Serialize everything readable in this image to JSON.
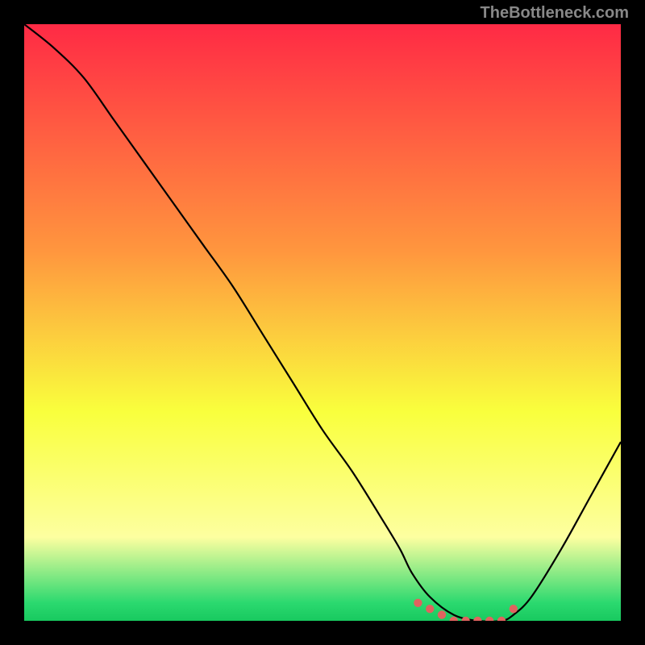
{
  "watermark": "TheBottleneck.com",
  "colors": {
    "red": "#ff2a45",
    "orange": "#ffa23e",
    "yellow": "#f9ff3d",
    "lightyellow": "#fdffa0",
    "green": "#2bd96f",
    "background": "#000000",
    "curve": "#000000",
    "marker": "#e0635f"
  },
  "chart_data": {
    "type": "line",
    "title": "",
    "xlabel": "",
    "ylabel": "",
    "xlim": [
      0,
      100
    ],
    "ylim": [
      0,
      100
    ],
    "series": [
      {
        "name": "bottleneck-curve",
        "x": [
          0,
          5,
          10,
          15,
          20,
          25,
          30,
          35,
          40,
          45,
          50,
          55,
          60,
          63,
          65,
          68,
          72,
          76,
          80,
          82,
          85,
          90,
          95,
          100
        ],
        "y": [
          100,
          96,
          91,
          84,
          77,
          70,
          63,
          56,
          48,
          40,
          32,
          25,
          17,
          12,
          8,
          4,
          1,
          0,
          0,
          1,
          4,
          12,
          21,
          30
        ]
      }
    ],
    "markers": {
      "name": "optimal-zone",
      "x": [
        66,
        68,
        70,
        72,
        74,
        76,
        78,
        80,
        82
      ],
      "y": [
        3,
        2,
        1,
        0,
        0,
        0,
        0,
        0,
        2
      ]
    },
    "gradient_stops": [
      {
        "offset": 0.0,
        "color": "#ff2a45"
      },
      {
        "offset": 0.38,
        "color": "#ff963e"
      },
      {
        "offset": 0.65,
        "color": "#f9ff3d"
      },
      {
        "offset": 0.86,
        "color": "#fdffa0"
      },
      {
        "offset": 0.97,
        "color": "#2bd96f"
      },
      {
        "offset": 1.0,
        "color": "#18c95f"
      }
    ]
  }
}
